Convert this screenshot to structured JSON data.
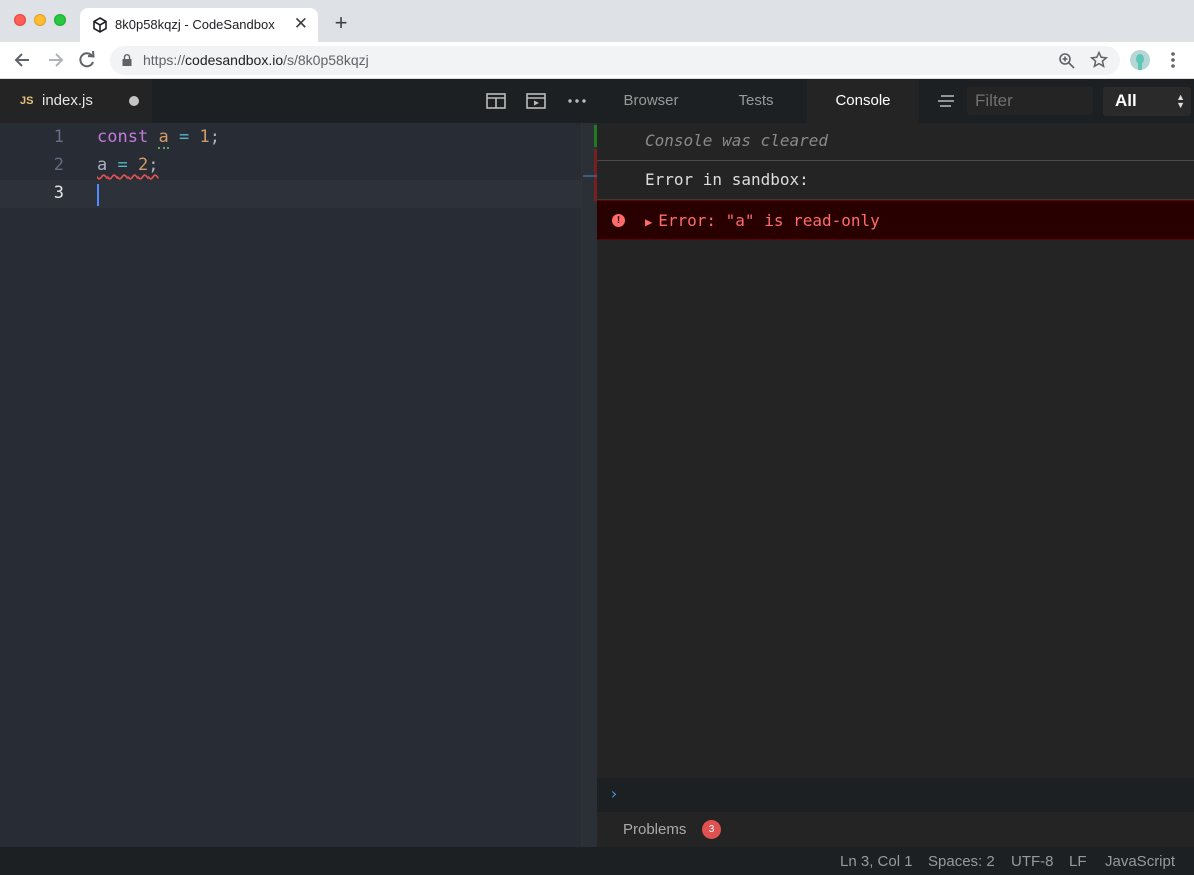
{
  "browser": {
    "tab_title": "8k0p58kqzj - CodeSandbox",
    "tab_close": "✕",
    "new_tab": "+",
    "url_scheme": "https://",
    "url_host": "codesandbox.io",
    "url_path": "/s/8k0p58kqzj"
  },
  "editor": {
    "file_js_badge": "JS",
    "file_name": "index.js",
    "lines": [
      {
        "number": "1",
        "tokens": {
          "kw": "const",
          "var": "a",
          "op": "=",
          "num": "1",
          "end": ";"
        }
      },
      {
        "number": "2",
        "tokens": {
          "var": "a",
          "op": "=",
          "num": "2",
          "end": ";"
        }
      },
      {
        "number": "3"
      }
    ]
  },
  "panel": {
    "tabs": [
      {
        "label": "Browser",
        "active": false
      },
      {
        "label": "Tests",
        "active": false
      },
      {
        "label": "Console",
        "active": true
      }
    ],
    "filter_placeholder": "Filter",
    "level_selected": "All"
  },
  "console": {
    "cleared_message": "Console was cleared",
    "info_message": "Error in sandbox:",
    "error_arrow": "▶",
    "error_message": "Error: \"a\" is read-only",
    "error_icon": "!",
    "prompt": "›"
  },
  "problems": {
    "label": "Problems",
    "count": "3"
  },
  "status": {
    "position": "Ln 3, Col 1",
    "spaces": "Spaces: 2",
    "encoding": "UTF-8",
    "eol": "LF",
    "language": "JavaScript"
  },
  "colors": {
    "error_red": "#ff6b6b",
    "keyword": "#c678dd",
    "number": "#d19a66",
    "operator": "#56b6c2"
  }
}
